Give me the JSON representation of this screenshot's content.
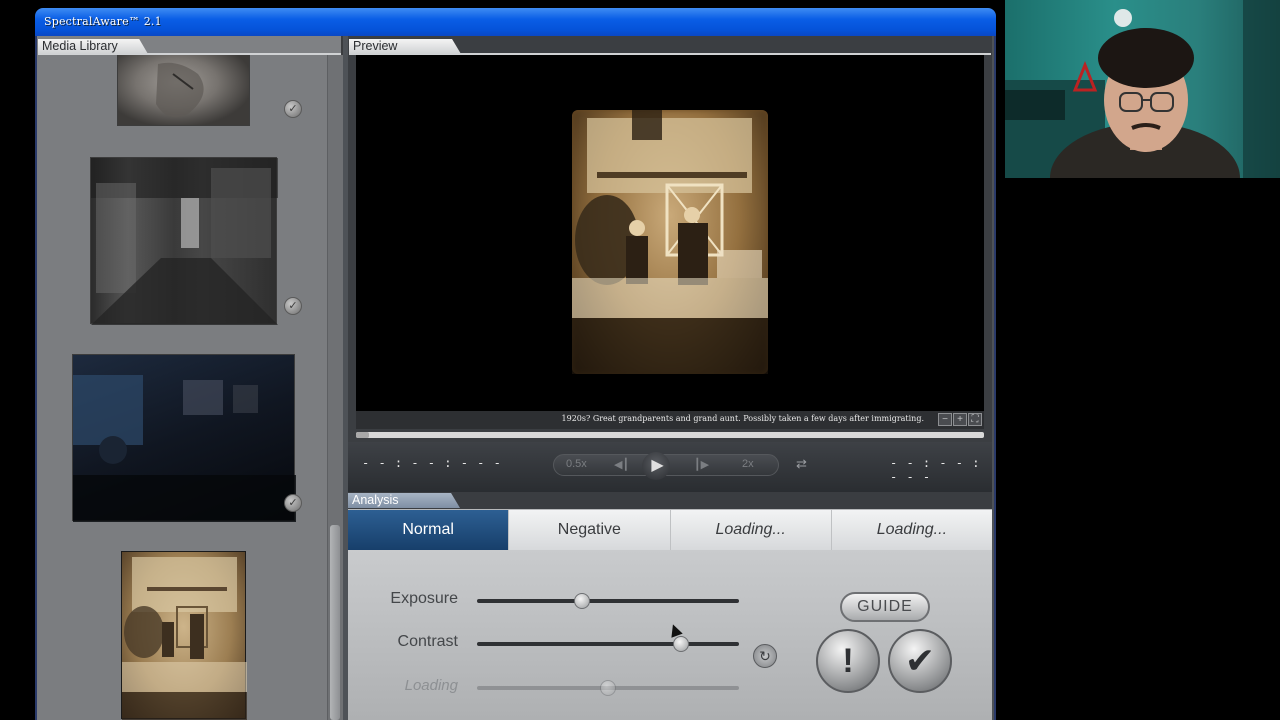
{
  "window": {
    "title": "SpectralAware™ 2.1"
  },
  "media_library": {
    "title": "Media Library",
    "items": [
      {
        "name": "item-1",
        "checked": true
      },
      {
        "name": "item-2",
        "checked": true
      },
      {
        "name": "item-3",
        "checked": true
      },
      {
        "name": "item-4",
        "selected": true
      }
    ]
  },
  "preview": {
    "title": "Preview",
    "caption": "1920s? Great grandparents and grand aunt. Possibly taken a few days after immigrating.",
    "zoom_out": "−",
    "zoom_in": "+",
    "fullscreen": "⛶",
    "progress_fraction": 0.02,
    "time_elapsed": "- - : - - : - - -",
    "time_total": "- - : - - : - - -",
    "speed_slow": "0.5x",
    "speed_fast": "2x",
    "prev_icon": "◀┃",
    "next_icon": "┃▶",
    "play_icon": "▶",
    "loop_icon": "⇄"
  },
  "analysis": {
    "title": "Analysis",
    "tabs": [
      {
        "label": "Normal",
        "active": true
      },
      {
        "label": "Negative",
        "active": false
      },
      {
        "label": "Loading...",
        "active": false
      },
      {
        "label": "Loading...",
        "active": false
      }
    ],
    "sliders": [
      {
        "label": "Exposure",
        "value": 0.4
      },
      {
        "label": "Contrast",
        "value": 0.78
      },
      {
        "label": "Loading",
        "value": 0.5
      }
    ],
    "guide_label": "GUIDE",
    "warn_icon": "!",
    "confirm_icon": "✔",
    "reset_icon": "↻"
  },
  "colors": {
    "title_bar": "#0a5ee6",
    "active_tab": "#1f4a7b"
  }
}
